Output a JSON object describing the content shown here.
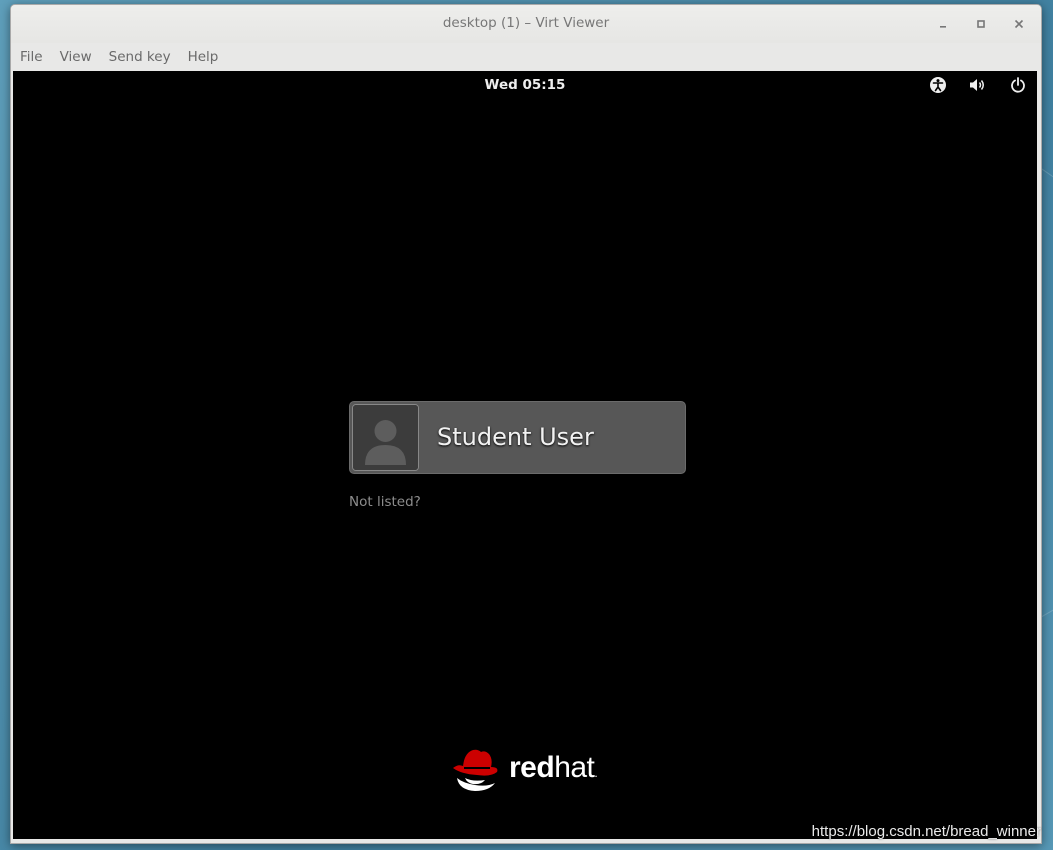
{
  "window": {
    "title": "desktop (1) – Virt Viewer",
    "controls": {
      "minimize": "–",
      "maximize": "□",
      "close": "×"
    }
  },
  "menu": {
    "items": [
      {
        "label": "File"
      },
      {
        "label": "View"
      },
      {
        "label": "Send key"
      },
      {
        "label": "Help"
      }
    ]
  },
  "vm": {
    "topbar": {
      "clock": "Wed 05:15",
      "icons": [
        "accessibility-icon",
        "volume-icon",
        "power-icon"
      ]
    },
    "login": {
      "user_name": "Student User",
      "avatar_icon": "user-avatar-icon",
      "not_listed": "Not listed?"
    },
    "brand": {
      "logo_icon": "redhat-logo-icon",
      "text_bold": "red",
      "text_regular": "hat",
      "text_trademark": "."
    }
  },
  "watermark": "https://blog.csdn.net/bread_winner",
  "colors": {
    "vm_background": "#000000",
    "user_card": "#575757",
    "brand_red": "#cc0000",
    "desktop": "#4a8aa8"
  }
}
